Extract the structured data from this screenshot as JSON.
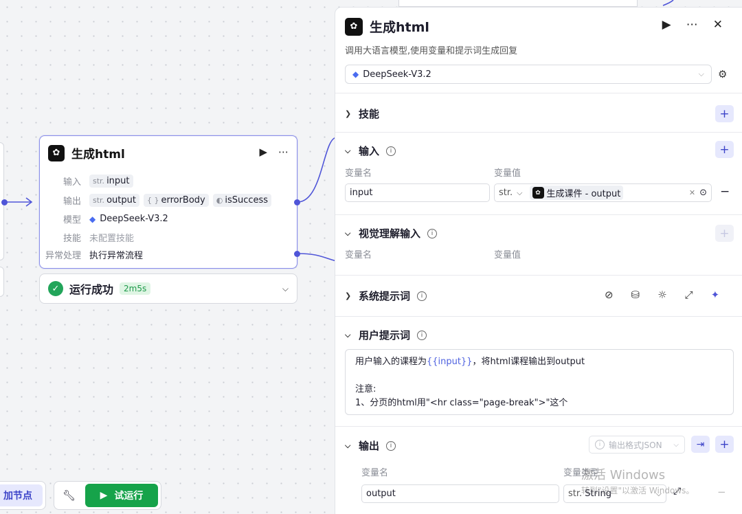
{
  "node": {
    "title": "生成html",
    "input_label": "输入",
    "input_tag_type": "str.",
    "input_tag_name": "input",
    "output_label": "输出",
    "output_tag_type": "str.",
    "output_tag_name": "output",
    "output_obj_icon": "{ }",
    "output_obj_name": "errorBody",
    "output_bool_name": "isSuccess",
    "model_label": "模型",
    "model_value": "DeepSeek-V3.2",
    "skill_label": "技能",
    "skill_value": "未配置技能",
    "exception_label": "异常处理",
    "exception_value": "执行异常流程"
  },
  "run_status": {
    "text": "运行成功",
    "duration": "2m5s"
  },
  "toolbar": {
    "add_node_label": "加节点",
    "run_label": "试运行"
  },
  "panel": {
    "title": "生成html",
    "description": "调用大语言模型,使用变量和提示词生成回复",
    "model": "DeepSeek-V3.2",
    "sections": {
      "skills": "技能",
      "input": "输入",
      "vision_input": "视觉理解输入",
      "system_prompt": "系统提示词",
      "user_prompt": "用户提示词",
      "output": "输出"
    },
    "col_var_name": "变量名",
    "col_var_value": "变量值",
    "input_row": {
      "name": "input",
      "type": "str.",
      "ref": "生成课件 - output"
    },
    "user_prompt": {
      "line1_before": "用户输入的课程为",
      "line1_var": "{{input}}",
      "line1_after": "，将html课程输出到output",
      "line3": "注意:",
      "line4": "1、分页的html用\"<hr class=\"page-break\">\"这个"
    },
    "output_format_label": "输出格式JSON",
    "output_col_name": "变量名",
    "output_col_type": "变量类型",
    "output_row": {
      "name": "output",
      "type_prefix": "str.",
      "type": "String"
    }
  },
  "watermark": {
    "line1": "激活 Windows",
    "line2": "转到\"设置\"以激活 Windows。"
  },
  "colors": {
    "accent": "#4f55d8",
    "success": "#16a34a",
    "node_border": "#8b8fe9"
  }
}
